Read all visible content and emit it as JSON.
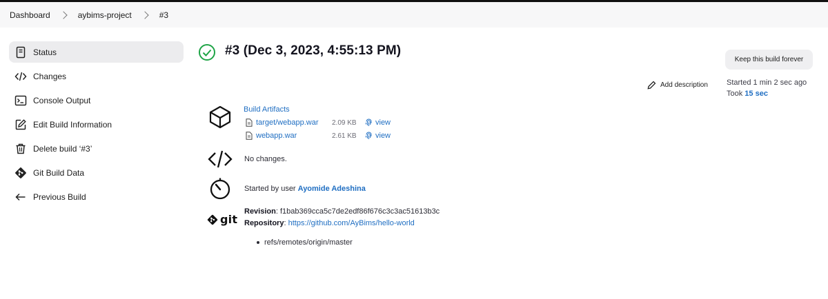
{
  "breadcrumb": [
    "Dashboard",
    "aybims-project",
    "#3"
  ],
  "sidebar": {
    "items": [
      {
        "label": "Status",
        "icon": "document-icon",
        "active": true
      },
      {
        "label": "Changes",
        "icon": "code-icon"
      },
      {
        "label": "Console Output",
        "icon": "terminal-icon"
      },
      {
        "label": "Edit Build Information",
        "icon": "edit-icon"
      },
      {
        "label": "Delete build ‘#3’",
        "icon": "trash-icon"
      },
      {
        "label": "Git Build Data",
        "icon": "git-icon"
      },
      {
        "label": "Previous Build",
        "icon": "arrow-left-icon"
      }
    ]
  },
  "build": {
    "title": "#3 (Dec 3, 2023, 4:55:13 PM)",
    "status_color": "#1ea446",
    "keep_forever_label": "Keep this build forever",
    "add_description_label": "Add description",
    "started": "Started 1 min 2 sec ago",
    "took_prefix": "Took ",
    "took_value": "15 sec"
  },
  "artifacts": {
    "title": "Build Artifacts",
    "files": [
      {
        "name": "target/webapp.war",
        "size": "2.09 KB",
        "view_label": "view"
      },
      {
        "name": "webapp.war",
        "size": "2.61 KB",
        "view_label": "view"
      }
    ]
  },
  "changes": {
    "text": "No changes."
  },
  "cause": {
    "prefix": "Started by user ",
    "user": "Ayomide Adeshina"
  },
  "git": {
    "logo_text": "git",
    "revision_label": "Revision",
    "revision": "f1bab369cca5c7de2edf86f676c3c3ac51613b3c",
    "repository_label": "Repository",
    "repository": "https://github.com/AyBims/hello-world",
    "branch": "refs/remotes/origin/master"
  },
  "colors": {
    "link": "#1f6ec2",
    "success": "#1ea446"
  }
}
